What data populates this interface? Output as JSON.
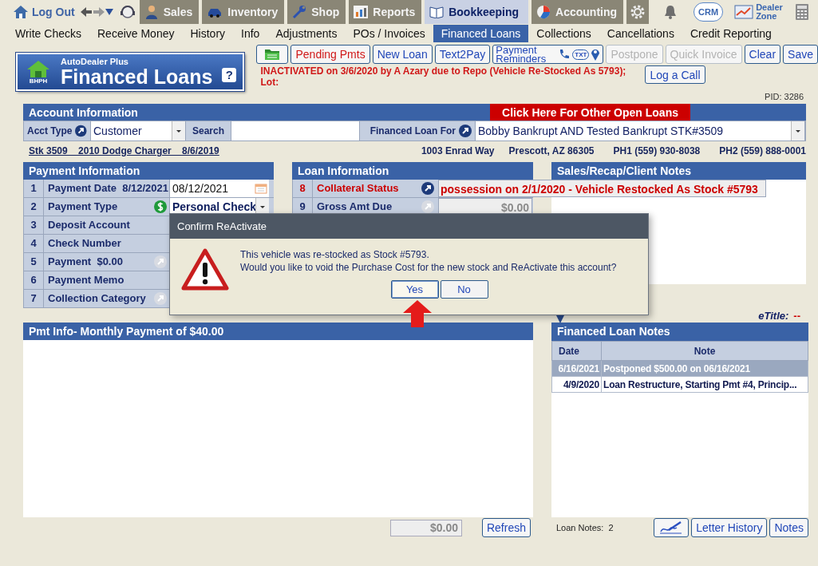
{
  "top_nav": {
    "logout": "Log Out",
    "modules": [
      {
        "label": "Sales",
        "selected": false
      },
      {
        "label": "Inventory",
        "selected": false
      },
      {
        "label": "Shop",
        "selected": false
      },
      {
        "label": "Reports",
        "selected": false
      },
      {
        "label": "Bookkeeping",
        "selected": true
      },
      {
        "label": "Accounting",
        "selected": false
      }
    ],
    "crm": "CRM",
    "dealer_zone": "Dealer Zone"
  },
  "menu": [
    {
      "label": "Write Checks",
      "selected": false
    },
    {
      "label": "Receive Money",
      "selected": false
    },
    {
      "label": "History",
      "selected": false
    },
    {
      "label": "Info",
      "selected": false
    },
    {
      "label": "Adjustments",
      "selected": false
    },
    {
      "label": "POs / Invoices",
      "selected": false
    },
    {
      "label": "Financed Loans",
      "selected": true
    },
    {
      "label": "Collections",
      "selected": false
    },
    {
      "label": "Cancellations",
      "selected": false
    },
    {
      "label": "Credit Reporting",
      "selected": false
    }
  ],
  "banner": {
    "subtitle": "AutoDealer Plus",
    "title": "Financed Loans",
    "badge": "BHPH",
    "help": "?"
  },
  "toolbar": [
    {
      "kind": "folder",
      "disabled": false
    },
    {
      "kind": "alert",
      "label": "Pending Pmts",
      "disabled": false
    },
    {
      "kind": "text",
      "label": "New Loan",
      "disabled": false
    },
    {
      "kind": "text",
      "label": "Text2Pay",
      "disabled": false
    },
    {
      "kind": "reminders",
      "label": "Payment Reminders",
      "badge": "TXT",
      "disabled": false
    },
    {
      "kind": "text",
      "label": "Postpone",
      "disabled": true
    },
    {
      "kind": "text",
      "label": "Quick Invoice",
      "disabled": true
    },
    {
      "kind": "text",
      "label": "Clear",
      "disabled": false
    },
    {
      "kind": "text",
      "label": "Save",
      "disabled": false
    }
  ],
  "status_message": [
    "INACTIVATED on 3/6/2020 by A Azary due to Repo (Vehicle Re-Stocked As 5793);",
    "Lot:"
  ],
  "log_call": "Log a Call",
  "pid": "PID: 3286",
  "account": {
    "title": "Account Information",
    "other_loans": "Click Here For Other Open Loans",
    "acct_type_label": "Acct Type",
    "acct_type": "Customer",
    "search_label": "Search",
    "loan_for_label": "Financed Loan For",
    "loan_for": "Bobby Bankrupt AND Tested Bankrupt STK#3509"
  },
  "vehicle_link": "Stk 3509    2010 Dodge Charger    8/6/2019",
  "contact": [
    "1003 Enrad Way",
    "Prescott, AZ 86305",
    "PH1 (559) 930-8038",
    "PH2 (559) 888-0001"
  ],
  "payment": {
    "title": "Payment Information",
    "rows": [
      {
        "num": "1",
        "label": "Payment Date  8/12/2021",
        "kind": "date",
        "value": "08/12/2021"
      },
      {
        "num": "2",
        "label": "Payment Type",
        "kind": "select",
        "value": "Personal Check"
      },
      {
        "num": "3",
        "label": "Deposit Account",
        "kind": "plain"
      },
      {
        "num": "4",
        "label": "Check Number",
        "kind": "plain"
      },
      {
        "num": "5",
        "label": "Payment  $0.00",
        "kind": "linked"
      },
      {
        "num": "6",
        "label": "Payment Memo",
        "kind": "plain"
      },
      {
        "num": "7",
        "label": "Collection Category",
        "kind": "linked"
      }
    ]
  },
  "loan": {
    "title": "Loan Information",
    "rows": [
      {
        "num": "8",
        "label": "Collateral Status",
        "alert": true,
        "disabled": false,
        "value": "possession on 2/1/2020 - Vehicle Restocked As Stock #5793"
      },
      {
        "num": "9",
        "label": "Gross Amt Due",
        "alert": false,
        "disabled": true,
        "value": "$0.00"
      }
    ]
  },
  "sales_notes": {
    "title": "Sales/Recap/Client Notes"
  },
  "dialog": {
    "title": "Confirm ReActivate",
    "message": [
      "This vehicle was re-stocked as Stock #5793.",
      "Would you like to void the Purchase Cost for the new stock and ReActivate this account?"
    ],
    "buttons": [
      {
        "label": "Yes",
        "selected": true
      },
      {
        "label": "No",
        "selected": false
      }
    ]
  },
  "etitle": {
    "label": "eTitle:",
    "value": "--"
  },
  "pmt_info": {
    "title": "Pmt Info- Monthly Payment of $40.00",
    "total": "$0.00",
    "refresh": "Refresh"
  },
  "loan_notes": {
    "title": "Financed Loan Notes",
    "columns": [
      "Date",
      "Note"
    ],
    "rows": [
      {
        "date": "6/16/2021",
        "note": "Postponed $500.00 on 06/16/2021",
        "selected": true
      },
      {
        "date": "4/9/2020",
        "note": "Loan Restructure, Starting Pmt #4, Princip...",
        "selected": false
      }
    ],
    "count_label": "Loan Notes:",
    "count": "2",
    "buttons": [
      "Letter History",
      "Notes"
    ]
  }
}
